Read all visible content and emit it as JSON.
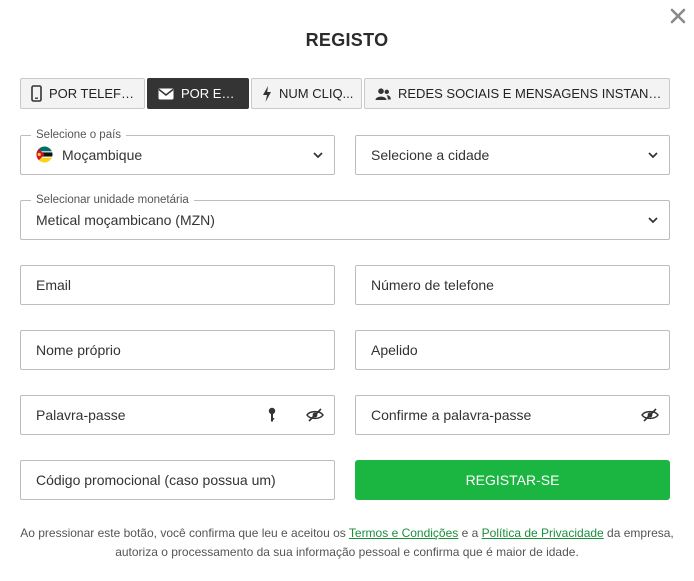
{
  "dialog": {
    "title": "REGISTO"
  },
  "tabs": [
    {
      "label": "POR TELEFO...",
      "icon": "phone-icon",
      "active": false
    },
    {
      "label": "POR EM...",
      "icon": "envelope-icon",
      "active": true
    },
    {
      "label": "NUM CLIQ...",
      "icon": "lightning-icon",
      "active": false
    },
    {
      "label": "REDES SOCIAIS E MENSAGENS INSTANTÂN...",
      "icon": "users-icon",
      "active": false
    }
  ],
  "country": {
    "legend": "Selecione o país",
    "value": "Moçambique",
    "flag": "mozambique-flag-icon"
  },
  "city": {
    "placeholder": "Selecione a cidade"
  },
  "currency": {
    "legend": "Selecionar unidade monetária",
    "value": "Metical moçambicano (MZN)"
  },
  "fields": {
    "email": "Email",
    "phone": "Número de telefone",
    "first_name": "Nome próprio",
    "last_name": "Apelido",
    "password": "Palavra-passe",
    "confirm_password": "Confirme a palavra-passe",
    "promo": "Código promocional (caso possua um)"
  },
  "submit": {
    "label": "REGISTAR-SE",
    "color": "#1bb542"
  },
  "footer": {
    "pre": "Ao pressionar este botão, você confirma que leu e aceitou os ",
    "terms": "Termos e Condições",
    "mid": " e a ",
    "privacy": "Política de Privacidade",
    "post1": " da empresa,",
    "post2": "autoriza o processamento da sua informação pessoal e confirma que é maior de idade."
  },
  "colors": {
    "accent": "#1bb542",
    "link": "#1b8f3a",
    "active_tab": "#343434"
  }
}
